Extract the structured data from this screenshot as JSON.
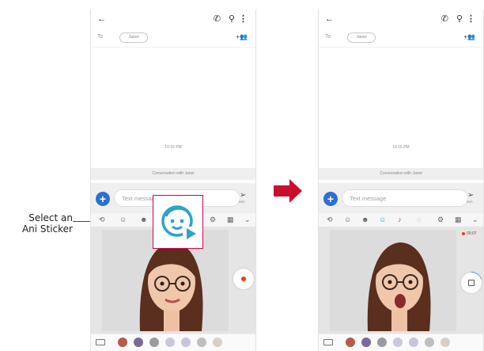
{
  "callout": {
    "line1": "Select an",
    "line2": "Ani Sticker"
  },
  "left_phone": {
    "to_label": "To",
    "recipient_chip": "Janet",
    "timestamp": "10:16 PM",
    "conversation_label": "Conversation with Janet",
    "compose_placeholder": "Text message",
    "send_label": "SMS"
  },
  "right_phone": {
    "to_label": "To",
    "recipient_chip": "Janet",
    "timestamp": "10:16 PM",
    "conversation_label": "Conversation with Janet",
    "compose_placeholder": "Text message",
    "send_label": "SMS",
    "recording_time": "00:07"
  },
  "colors": {
    "accent_highlight": "#d9004f",
    "plus_button": "#2f6fd1",
    "ani_sticker_icon": "#2da3c9",
    "record_dot": "#e2401b"
  }
}
